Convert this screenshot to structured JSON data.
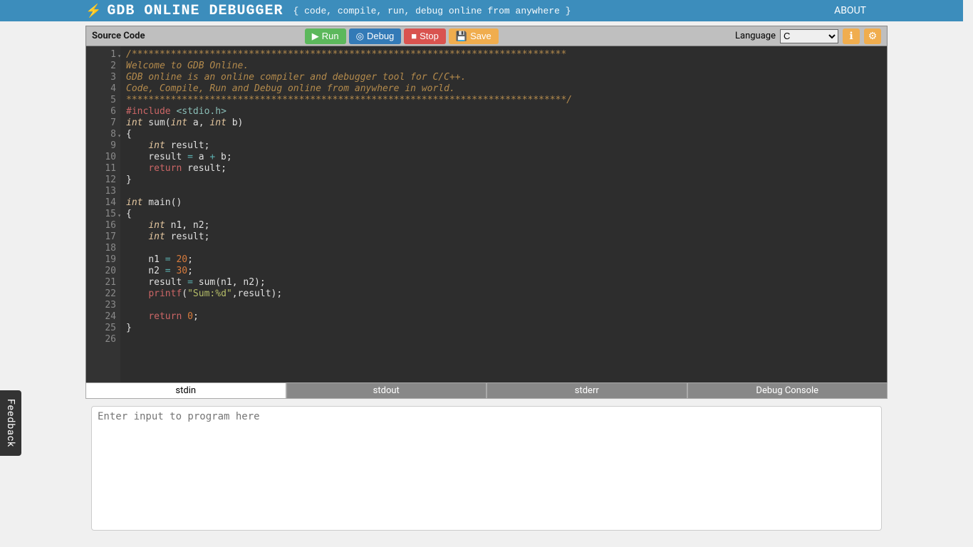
{
  "header": {
    "logo_text": "GDB ONLINE DEBUGGER",
    "tagline": "{ code, compile, run, debug online from anywhere }",
    "about": "ABOUT"
  },
  "toolbar": {
    "label": "Source Code",
    "run": "Run",
    "debug": "Debug",
    "stop": "Stop",
    "save": "Save",
    "language_label": "Language",
    "language_selected": "C"
  },
  "code": {
    "line_count": 26,
    "fold_lines": [
      1,
      8,
      15
    ],
    "lines": [
      {
        "tokens": [
          {
            "cls": "tok-comment",
            "t": "/******************************************************************************"
          }
        ]
      },
      {
        "tokens": [
          {
            "cls": "tok-comment",
            "t": "Welcome to GDB Online."
          }
        ]
      },
      {
        "tokens": [
          {
            "cls": "tok-comment",
            "t": "GDB online is an online compiler and debugger tool for C/C++."
          }
        ]
      },
      {
        "tokens": [
          {
            "cls": "tok-comment",
            "t": "Code, Compile, Run and Debug online from anywhere in world."
          }
        ]
      },
      {
        "tokens": [
          {
            "cls": "tok-comment",
            "t": "*******************************************************************************/"
          }
        ]
      },
      {
        "tokens": [
          {
            "cls": "tok-pp",
            "t": "#include "
          },
          {
            "cls": "tok-header",
            "t": "<stdio.h>"
          }
        ]
      },
      {
        "tokens": [
          {
            "cls": "tok-type",
            "t": "int"
          },
          {
            "cls": "tok-plain",
            "t": " sum("
          },
          {
            "cls": "tok-type",
            "t": "int"
          },
          {
            "cls": "tok-plain",
            "t": " a, "
          },
          {
            "cls": "tok-type",
            "t": "int"
          },
          {
            "cls": "tok-plain",
            "t": " b)"
          }
        ]
      },
      {
        "tokens": [
          {
            "cls": "tok-plain",
            "t": "{"
          }
        ]
      },
      {
        "tokens": [
          {
            "cls": "tok-plain",
            "t": "    "
          },
          {
            "cls": "tok-type",
            "t": "int"
          },
          {
            "cls": "tok-plain",
            "t": " result;"
          }
        ]
      },
      {
        "tokens": [
          {
            "cls": "tok-plain",
            "t": "    result "
          },
          {
            "cls": "tok-op",
            "t": "="
          },
          {
            "cls": "tok-plain",
            "t": " a "
          },
          {
            "cls": "tok-op",
            "t": "+"
          },
          {
            "cls": "tok-plain",
            "t": " b;"
          }
        ]
      },
      {
        "tokens": [
          {
            "cls": "tok-plain",
            "t": "    "
          },
          {
            "cls": "tok-keyword",
            "t": "return"
          },
          {
            "cls": "tok-plain",
            "t": " result;"
          }
        ]
      },
      {
        "tokens": [
          {
            "cls": "tok-plain",
            "t": "}"
          }
        ]
      },
      {
        "tokens": []
      },
      {
        "tokens": [
          {
            "cls": "tok-type",
            "t": "int"
          },
          {
            "cls": "tok-plain",
            "t": " main()"
          }
        ]
      },
      {
        "tokens": [
          {
            "cls": "tok-plain",
            "t": "{"
          }
        ]
      },
      {
        "tokens": [
          {
            "cls": "tok-plain",
            "t": "    "
          },
          {
            "cls": "tok-type",
            "t": "int"
          },
          {
            "cls": "tok-plain",
            "t": " n1, n2;"
          }
        ]
      },
      {
        "tokens": [
          {
            "cls": "tok-plain",
            "t": "    "
          },
          {
            "cls": "tok-type",
            "t": "int"
          },
          {
            "cls": "tok-plain",
            "t": " result;"
          }
        ]
      },
      {
        "tokens": []
      },
      {
        "tokens": [
          {
            "cls": "tok-plain",
            "t": "    n1 "
          },
          {
            "cls": "tok-op",
            "t": "="
          },
          {
            "cls": "tok-plain",
            "t": " "
          },
          {
            "cls": "tok-num",
            "t": "20"
          },
          {
            "cls": "tok-plain",
            "t": ";"
          }
        ]
      },
      {
        "tokens": [
          {
            "cls": "tok-plain",
            "t": "    n2 "
          },
          {
            "cls": "tok-op",
            "t": "="
          },
          {
            "cls": "tok-plain",
            "t": " "
          },
          {
            "cls": "tok-num",
            "t": "30"
          },
          {
            "cls": "tok-plain",
            "t": ";"
          }
        ]
      },
      {
        "tokens": [
          {
            "cls": "tok-plain",
            "t": "    result "
          },
          {
            "cls": "tok-op",
            "t": "="
          },
          {
            "cls": "tok-plain",
            "t": " sum(n1, n2);"
          }
        ]
      },
      {
        "tokens": [
          {
            "cls": "tok-plain",
            "t": "    "
          },
          {
            "cls": "tok-call",
            "t": "printf"
          },
          {
            "cls": "tok-plain",
            "t": "("
          },
          {
            "cls": "tok-str",
            "t": "\"Sum:%d\""
          },
          {
            "cls": "tok-plain",
            "t": ",result);"
          }
        ]
      },
      {
        "tokens": []
      },
      {
        "tokens": [
          {
            "cls": "tok-plain",
            "t": "    "
          },
          {
            "cls": "tok-keyword",
            "t": "return"
          },
          {
            "cls": "tok-plain",
            "t": " "
          },
          {
            "cls": "tok-num",
            "t": "0"
          },
          {
            "cls": "tok-plain",
            "t": ";"
          }
        ]
      },
      {
        "tokens": [
          {
            "cls": "tok-plain",
            "t": "}"
          }
        ]
      },
      {
        "tokens": []
      }
    ]
  },
  "bottom_tabs": {
    "stdin": "stdin",
    "stdout": "stdout",
    "stderr": "stderr",
    "debug_console": "Debug Console"
  },
  "stdin_placeholder": "Enter input to program here",
  "feedback": "Feedback"
}
